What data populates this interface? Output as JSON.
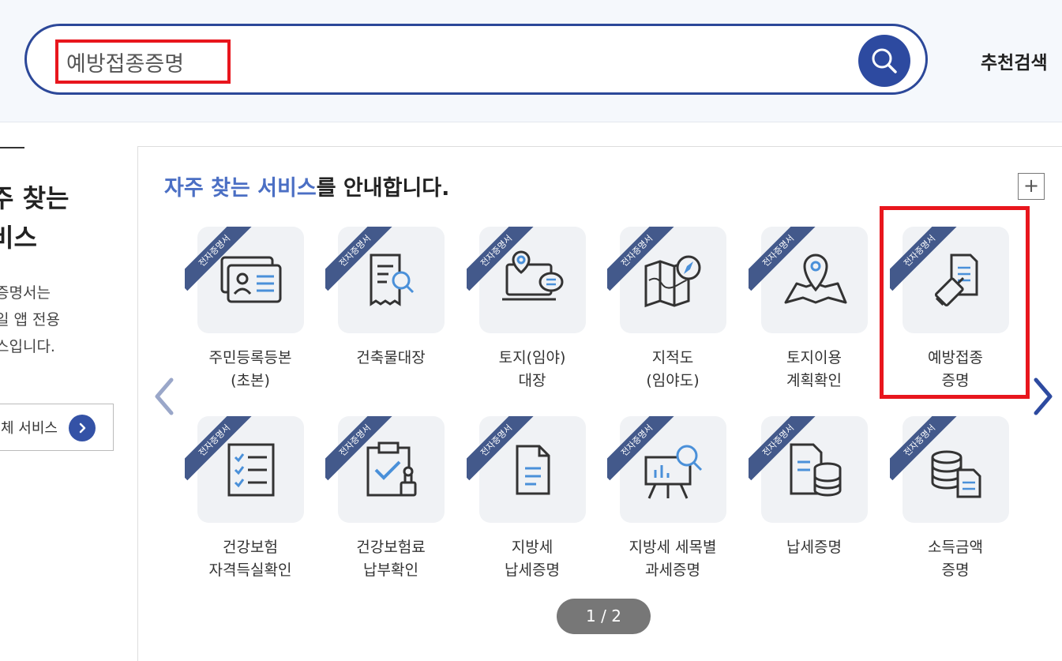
{
  "search": {
    "value": "예방접종증명",
    "button_icon": "search-icon",
    "recommend_label": "추천검색"
  },
  "left_panel": {
    "title_line1": "주 찾는",
    "title_line2": "비스",
    "desc_line1": "증명서는",
    "desc_line2": "일 앱 전용",
    "desc_line3": "스입니다.",
    "button_label": "체 서비스",
    "button_icon": "chevron-right-icon"
  },
  "main": {
    "heading_highlight": "자주 찾는 서비스",
    "heading_rest": "를 안내합니다.",
    "plus_label": "+",
    "ribbon_label": "전자증명서",
    "pager": "1 / 2",
    "prev_icon": "chevron-left-icon",
    "next_icon": "chevron-right-icon",
    "tiles": [
      {
        "line1": "주민등록등본",
        "line2": "(초본)",
        "icon": "id-card-icon"
      },
      {
        "line1": "건축물대장",
        "line2": "",
        "icon": "document-search-icon"
      },
      {
        "line1": "토지(임야)",
        "line2": "대장",
        "icon": "map-pin-laptop-icon"
      },
      {
        "line1": "지적도",
        "line2": "(임야도)",
        "icon": "map-compass-icon"
      },
      {
        "line1": "토지이용",
        "line2": "계획확인",
        "icon": "map-pin-icon"
      },
      {
        "line1": "예방접종",
        "line2": "증명",
        "icon": "syringe-document-icon"
      },
      {
        "line1": "건강보험",
        "line2": "자격득실확인",
        "icon": "checklist-icon"
      },
      {
        "line1": "건강보험료",
        "line2": "납부확인",
        "icon": "clipboard-stamp-icon"
      },
      {
        "line1": "지방세",
        "line2": "납세증명",
        "icon": "document-icon"
      },
      {
        "line1": "지방세 세목별",
        "line2": "과세증명",
        "icon": "presentation-chart-icon"
      },
      {
        "line1": "납세증명",
        "line2": "",
        "icon": "document-database-icon"
      },
      {
        "line1": "소득금액",
        "line2": "증명",
        "icon": "database-document-icon"
      }
    ]
  },
  "colors": {
    "brand": "#2d4aa0",
    "heading_highlight": "#4b6fc4",
    "ribbon": "#43598b",
    "highlight_border": "#e8161d"
  }
}
